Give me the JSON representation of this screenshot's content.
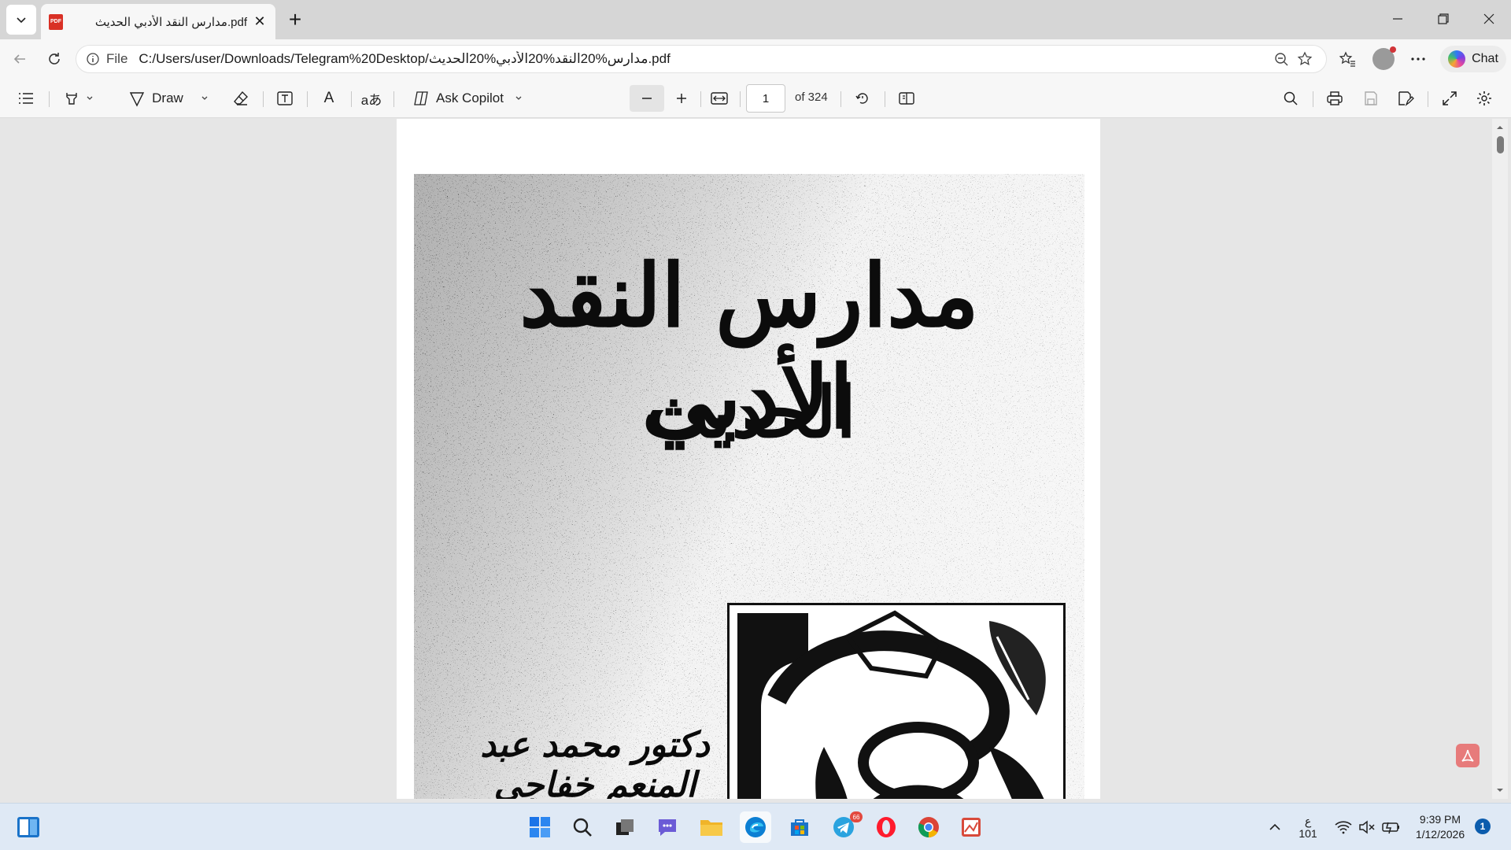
{
  "browser": {
    "tab_title": "مدارس النقد الأدبي الحديث.pdf",
    "pdf_badge": "PDF",
    "close_glyph": "✕",
    "new_tab_glyph": "+",
    "window_controls": {
      "minimize": "—",
      "maximize": "❐",
      "close": "✕"
    },
    "url_scheme": "File",
    "url": "C:/Users/user/Downloads/Telegram%20Desktop/مدارس%20النقد%20الأدبي%20الحديث.pdf",
    "chat_label": "Chat"
  },
  "pdf_toolbar": {
    "draw_label": "Draw",
    "copilot_label": "Ask Copilot",
    "translate_glyph": "aあ",
    "read_aloud_glyph": "A",
    "current_page": "1",
    "page_total": "of 324"
  },
  "document": {
    "title": "مدارس النقد الأدبي",
    "subtitle": "الحديث",
    "author": "دكتور محمد عبد المنعم خفاجي"
  },
  "taskbar": {
    "lang_line1": "ع",
    "lang_line2": "101",
    "time": "9:39 PM",
    "date": "1/12/2026",
    "notification_count": "1",
    "telegram_badge": "66"
  },
  "colors": {
    "accent": "#0b5cad",
    "pdf_red": "#d93025",
    "toolbar_bg": "#f7f7f7",
    "content_bg": "#e6e6e6"
  },
  "icons": [
    "tab-actions-icon",
    "pdf-file-icon",
    "back-arrow-icon",
    "refresh-icon",
    "info-icon",
    "zoom-out-icon",
    "favorite-star-icon",
    "favorites-icon",
    "profile-avatar",
    "more-dots-icon",
    "copilot-icon",
    "contents-icon",
    "highlight-icon",
    "draw-icon",
    "erase-icon",
    "text-box-icon",
    "read-aloud-icon",
    "translate-icon",
    "fit-width-icon",
    "rotate-icon",
    "page-view-icon",
    "search-icon",
    "print-icon",
    "save-icon",
    "save-as-icon",
    "fullscreen-icon",
    "settings-gear-icon",
    "windows-start-icon",
    "taskbar-search-icon",
    "task-view-icon",
    "chat-icon",
    "file-explorer-icon",
    "edge-icon",
    "store-icon",
    "telegram-icon",
    "opera-icon",
    "chrome-icon",
    "image-app-icon",
    "chevron-up-icon",
    "wifi-icon",
    "volume-muted-icon",
    "battery-icon"
  ]
}
